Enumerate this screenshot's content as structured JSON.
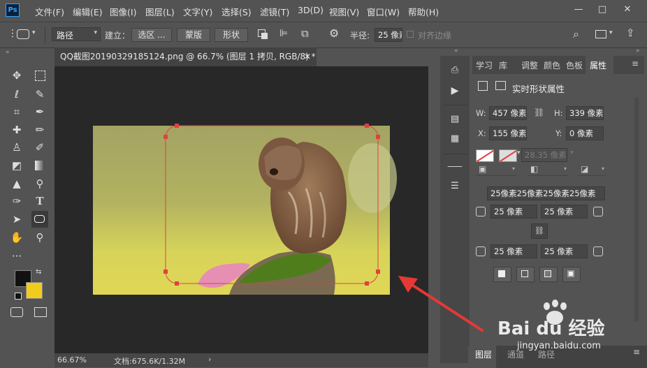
{
  "app": {
    "logo": "Ps"
  },
  "menu": [
    "文件(F)",
    "编辑(E)",
    "图像(I)",
    "图层(L)",
    "文字(Y)",
    "选择(S)",
    "滤镜(T)",
    "3D(D)",
    "视图(V)",
    "窗口(W)",
    "帮助(H)"
  ],
  "window_controls": {
    "minimize": "—",
    "maximize": "□",
    "close": "✕"
  },
  "options": {
    "mode_select": "路径",
    "build_label": "建立：",
    "selection_button": "选区 ...",
    "mask_button": "蒙版",
    "shape_button": "形状",
    "radius_label": "半径:",
    "radius_value": "25 像素",
    "align_edges_label": "对齐边缘"
  },
  "document": {
    "tab_title": "QQ截图20190329185124.png @ 66.7% (图层 1 拷贝, RGB/8) *",
    "zoom": "66.67%",
    "doc_size": "文档:675.6K/1.32M"
  },
  "panel_tabs": [
    "学习",
    "库",
    "调整",
    "颜色",
    "色板",
    "属性"
  ],
  "properties": {
    "title": "实时形状属性",
    "w_label": "W:",
    "w_value": "457 像素",
    "h_label": "H:",
    "h_value": "339 像素",
    "x_label": "X:",
    "x_value": "155 像素",
    "y_label": "Y:",
    "y_value": "0 像素",
    "stroke_width": "28.35 像素",
    "corners_combined": "25像素25像素25像素25像素",
    "corner_tl": "25 像素",
    "corner_tr": "25 像素",
    "corner_bl": "25 像素",
    "corner_br": "25 像素"
  },
  "bottom_tabs": [
    "图层",
    "通道",
    "路径"
  ],
  "watermark": {
    "brand": "Bai du 经验",
    "url": "jingyan.baidu.com"
  },
  "colors": {
    "foreground": "#111111",
    "background": "#f2cc1c",
    "path": "#e04040",
    "arrow": "#e53935",
    "accent": "#31a8ff"
  }
}
